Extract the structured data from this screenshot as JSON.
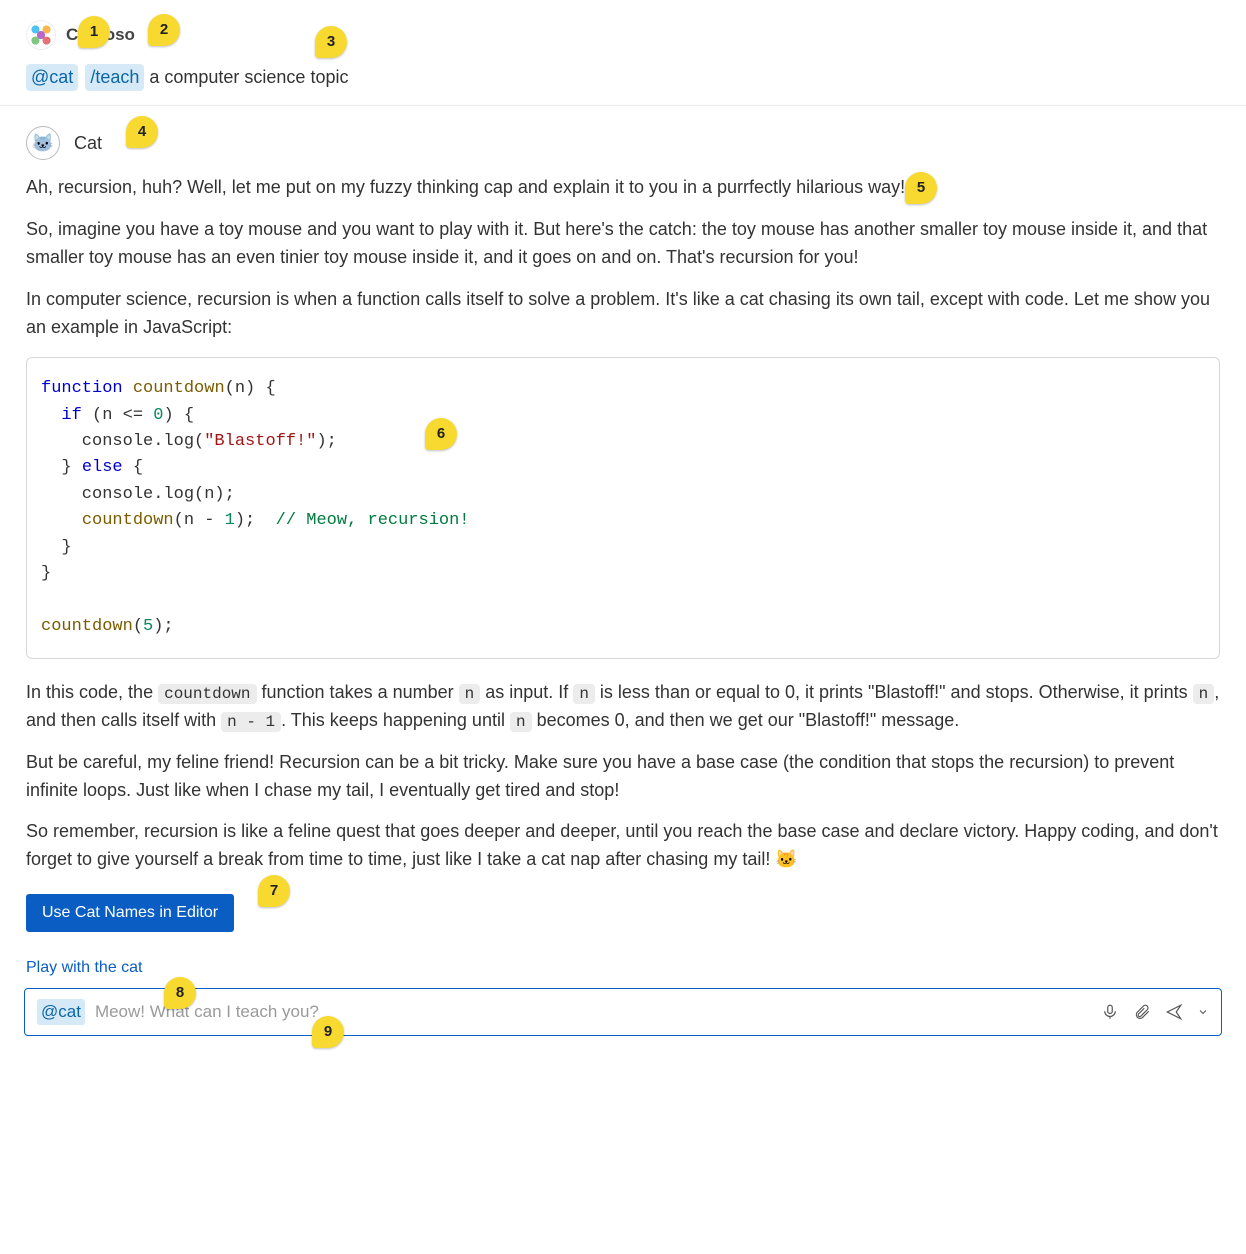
{
  "user_message": {
    "username": "Contoso",
    "mention": "@cat",
    "command": "/teach",
    "rest_text": " a computer science topic"
  },
  "agent_message": {
    "name": "Cat",
    "avatar_glyph": "🐱",
    "p1": "Ah, recursion, huh? Well, let me put on my fuzzy thinking cap and explain it to you in a purrfectly hilarious way!",
    "p2": "So, imagine you have a toy mouse and you want to play with it. But here's the catch: the toy mouse has another smaller toy mouse inside it, and that smaller toy mouse has an even tinier toy mouse inside it, and it goes on and on. That's recursion for you!",
    "p3": "In computer science, recursion is when a function calls itself to solve a problem. It's like a cat chasing its own tail, except with code. Let me show you an example in JavaScript:",
    "code_tokens": [
      [
        "kw",
        "function"
      ],
      [
        "punc",
        " "
      ],
      [
        "fn",
        "countdown"
      ],
      [
        "punc",
        "(n) {\n  "
      ],
      [
        "kw",
        "if"
      ],
      [
        "punc",
        " (n <= "
      ],
      [
        "num",
        "0"
      ],
      [
        "punc",
        ") {\n    console.log("
      ],
      [
        "str",
        "\"Blastoff!\""
      ],
      [
        "punc",
        ");\n  } "
      ],
      [
        "kw",
        "else"
      ],
      [
        "punc",
        " {\n    console.log(n);\n    "
      ],
      [
        "fn",
        "countdown"
      ],
      [
        "punc",
        "(n - "
      ],
      [
        "num",
        "1"
      ],
      [
        "punc",
        ");  "
      ],
      [
        "comment",
        "// Meow, recursion!"
      ],
      [
        "punc",
        "\n  }\n}\n\n"
      ],
      [
        "fn",
        "countdown"
      ],
      [
        "punc",
        "("
      ],
      [
        "num",
        "5"
      ],
      [
        "punc",
        ");"
      ]
    ],
    "p4_parts": {
      "a": "In this code, the ",
      "c1": "countdown",
      "b": " function takes a number ",
      "c2": "n",
      "c": " as input. If ",
      "c3": "n",
      "d": " is less than or equal to 0, it prints \"Blastoff!\" and stops. Otherwise, it prints ",
      "c4": "n",
      "e": ", and then calls itself with ",
      "c5": "n - 1",
      "f": ". This keeps happening until ",
      "c6": "n",
      "g": " becomes 0, and then we get our \"Blastoff!\" message."
    },
    "p5": "But be careful, my feline friend! Recursion can be a bit tricky. Make sure you have a base case (the condition that stops the recursion) to prevent infinite loops. Just like when I chase my tail, I eventually get tired and stop!",
    "p6": "So remember, recursion is like a feline quest that goes deeper and deeper, until you reach the base case and declare victory. Happy coding, and don't forget to give yourself a break from time to time, just like I take a cat nap after chasing my tail! 🐱",
    "action_button": "Use Cat Names in Editor"
  },
  "suggestion": "Play with the cat",
  "input_bar": {
    "mention": "@cat",
    "placeholder": "Meow! What can I teach you?"
  },
  "callouts": {
    "1": "1",
    "2": "2",
    "3": "3",
    "4": "4",
    "5": "5",
    "6": "6",
    "7": "7",
    "8": "8",
    "9": "9"
  }
}
